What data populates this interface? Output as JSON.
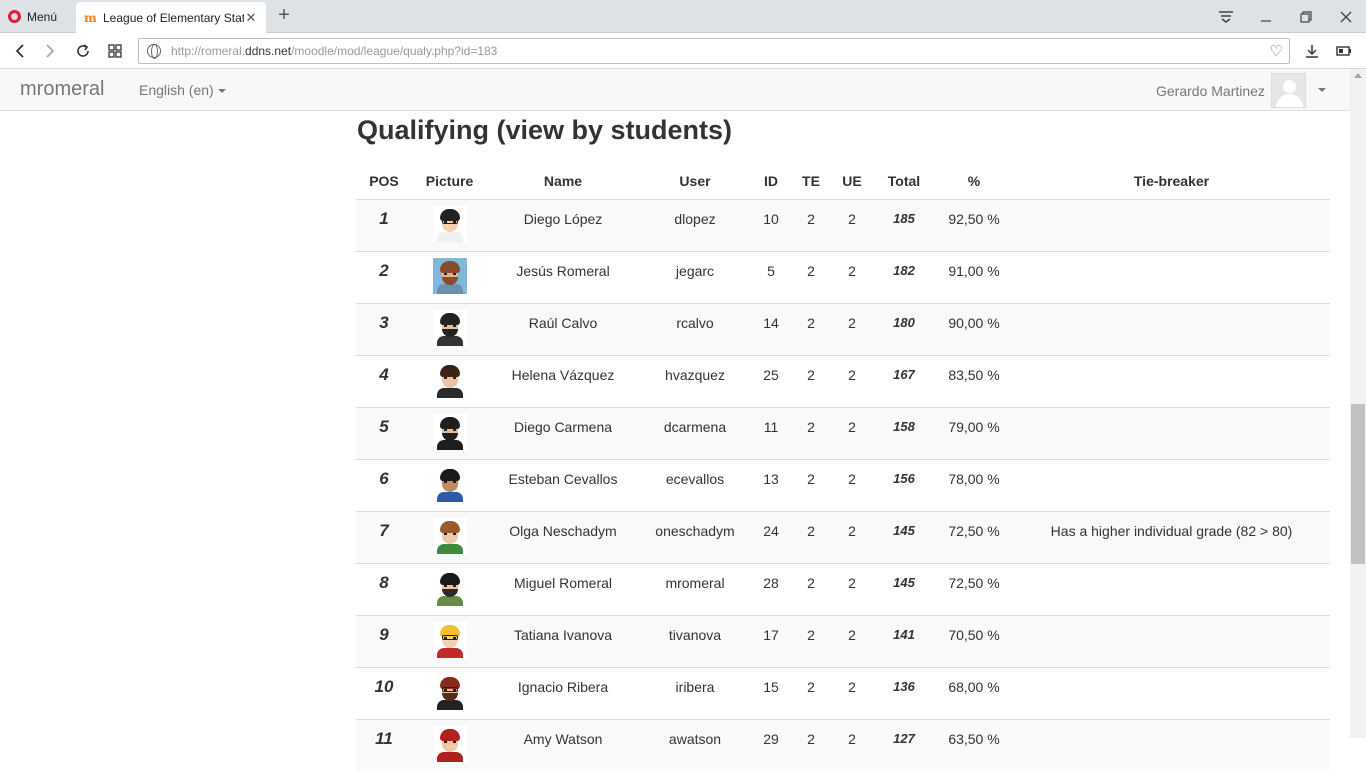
{
  "browser": {
    "menu_label": "Menú",
    "tab_title": "League of Elementary Stat",
    "url_scheme": "http://romeral.",
    "url_host": "ddns.net",
    "url_path": "/moodle/mod/league/qualy.php?id=183"
  },
  "navbar": {
    "brand": "mromeral",
    "language": "English (en)",
    "user_name": "Gerardo Martinez"
  },
  "page": {
    "title": "Qualifying (view by students)"
  },
  "table": {
    "headers": [
      "POS",
      "Picture",
      "Name",
      "User",
      "ID",
      "TE",
      "UE",
      "Total",
      "%",
      "Tie-breaker"
    ],
    "rows": [
      {
        "pos": "1",
        "name": "Diego López",
        "user": "dlopez",
        "id": "10",
        "te": "2",
        "ue": "2",
        "total": "185",
        "pct": "92,50 %",
        "tie": "",
        "avatar": {
          "bg": "#ffffff",
          "hair": "#222222",
          "skin": "#f5d0b0",
          "beard": "",
          "body": "#f0f0f0",
          "glasses": true
        }
      },
      {
        "pos": "2",
        "name": "Jesús Romeral",
        "user": "jegarc",
        "id": "5",
        "te": "2",
        "ue": "2",
        "total": "182",
        "pct": "91,00 %",
        "tie": "",
        "avatar": {
          "bg": "#7fb8d8",
          "hair": "#8a4b2a",
          "skin": "#e8b090",
          "beard": "#8a4b2a",
          "body": "#6a8fb0",
          "glasses": false
        }
      },
      {
        "pos": "3",
        "name": "Raúl Calvo",
        "user": "rcalvo",
        "id": "14",
        "te": "2",
        "ue": "2",
        "total": "180",
        "pct": "90,00 %",
        "tie": "",
        "avatar": {
          "bg": "#ffffff",
          "hair": "#222222",
          "skin": "#e8c0a0",
          "beard": "#222222",
          "body": "#333333",
          "glasses": false
        }
      },
      {
        "pos": "4",
        "name": "Helena Vázquez",
        "user": "hvazquez",
        "id": "25",
        "te": "2",
        "ue": "2",
        "total": "167",
        "pct": "83,50 %",
        "tie": "",
        "avatar": {
          "bg": "#ffffff",
          "hair": "#3a2418",
          "skin": "#eac4a4",
          "beard": "",
          "body": "#2a2a2a",
          "glasses": false
        }
      },
      {
        "pos": "5",
        "name": "Diego Carmena",
        "user": "dcarmena",
        "id": "11",
        "te": "2",
        "ue": "2",
        "total": "158",
        "pct": "79,00 %",
        "tie": "",
        "avatar": {
          "bg": "#ffffff",
          "hair": "#1e1e1e",
          "skin": "#e6bc98",
          "beard": "#1e1e1e",
          "body": "#1e1e1e",
          "glasses": false
        }
      },
      {
        "pos": "6",
        "name": "Esteban Cevallos",
        "user": "ecevallos",
        "id": "13",
        "te": "2",
        "ue": "2",
        "total": "156",
        "pct": "78,00 %",
        "tie": "",
        "avatar": {
          "bg": "#ffffff",
          "hair": "#1a1a1a",
          "skin": "#c08a62",
          "beard": "",
          "body": "#2f5aa8",
          "glasses": false
        }
      },
      {
        "pos": "7",
        "name": "Olga Neschadym",
        "user": "oneschadym",
        "id": "24",
        "te": "2",
        "ue": "2",
        "total": "145",
        "pct": "72,50 %",
        "tie": "Has a higher individual grade (82 > 80)",
        "avatar": {
          "bg": "#ffffff",
          "hair": "#9a5a2a",
          "skin": "#f0c8a8",
          "beard": "",
          "body": "#3f8a3f",
          "glasses": false
        }
      },
      {
        "pos": "8",
        "name": "Miguel Romeral",
        "user": "mromeral",
        "id": "28",
        "te": "2",
        "ue": "2",
        "total": "145",
        "pct": "72,50 %",
        "tie": "",
        "avatar": {
          "bg": "#ffffff",
          "hair": "#1a1a1a",
          "skin": "#eac4a0",
          "beard": "#2a2a2a",
          "body": "#6a8a4a",
          "glasses": false
        }
      },
      {
        "pos": "9",
        "name": "Tatiana Ivanova",
        "user": "tivanova",
        "id": "17",
        "te": "2",
        "ue": "2",
        "total": "141",
        "pct": "70,50 %",
        "tie": "",
        "avatar": {
          "bg": "#ffffff",
          "hair": "#f0c030",
          "skin": "#f2d2b4",
          "beard": "",
          "body": "#c02a2a",
          "glasses": true
        }
      },
      {
        "pos": "10",
        "name": "Ignacio Ribera",
        "user": "iribera",
        "id": "15",
        "te": "2",
        "ue": "2",
        "total": "136",
        "pct": "68,00 %",
        "tie": "",
        "avatar": {
          "bg": "#ffffff",
          "hair": "#8a2a1a",
          "skin": "#eac0a0",
          "beard": "#5a2a1a",
          "body": "#222222",
          "glasses": true
        }
      },
      {
        "pos": "11",
        "name": "Amy Watson",
        "user": "awatson",
        "id": "29",
        "te": "2",
        "ue": "2",
        "total": "127",
        "pct": "63,50 %",
        "tie": "",
        "avatar": {
          "bg": "#ffffff",
          "hair": "#b02020",
          "skin": "#f0c8a8",
          "beard": "",
          "body": "#b02020",
          "glasses": false
        }
      }
    ]
  }
}
